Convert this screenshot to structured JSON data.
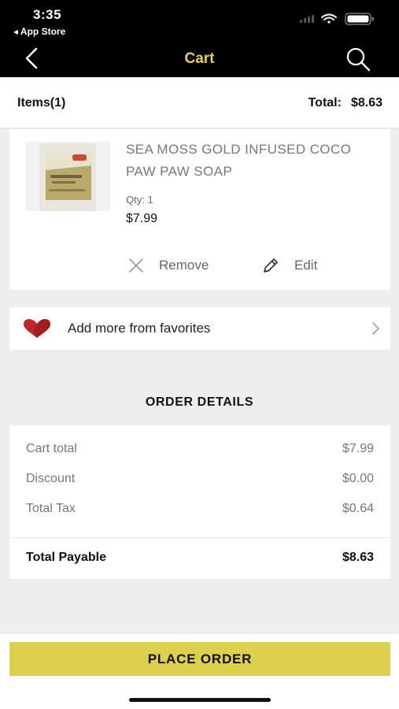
{
  "status_bar": {
    "time": "3:35",
    "back_app": "◂ App Store"
  },
  "nav": {
    "title": "Cart",
    "back_icon": "chevron-left-icon",
    "search_icon": "search-icon"
  },
  "items_bar": {
    "count": "Items(1)",
    "total_label": "Total:",
    "total_value": "$8.63"
  },
  "cart_item": {
    "name": "SEA MOSS GOLD INFUSED COCO PAW PAW SOAP",
    "qty": "Qty: 1",
    "price": "$7.99",
    "remove_label": "Remove",
    "edit_label": "Edit"
  },
  "favorites": {
    "label": "Add more from favorites"
  },
  "order_details": {
    "title": "ORDER DETAILS",
    "rows": [
      {
        "label": "Cart total",
        "value": "$7.99"
      },
      {
        "label": "Discount",
        "value": "$0.00"
      },
      {
        "label": "Total Tax",
        "value": "$0.64"
      }
    ],
    "total": {
      "label": "Total Payable",
      "value": "$8.63"
    }
  },
  "footer": {
    "place_order_label": "PLACE ORDER"
  },
  "colors": {
    "accent": "#ddd04c",
    "title": "#e6cf4e",
    "heart": "#c0262b"
  }
}
